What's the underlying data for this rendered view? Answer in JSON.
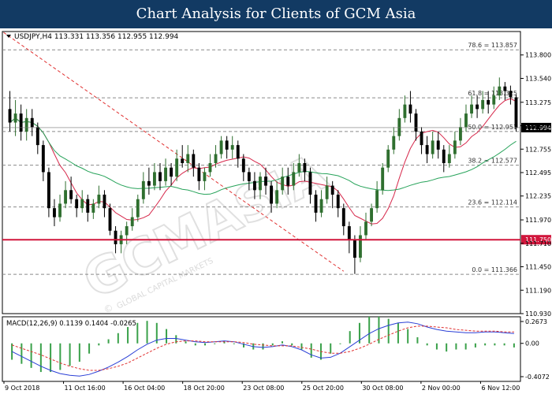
{
  "banner": {
    "title": "Chart Analysis for Clients of GCM Asia"
  },
  "chart_data": {
    "type": "candlestick",
    "header": "USDJPY,H4  113.331 113.356 112.955 112.994",
    "price_axis": {
      "min": 110.93,
      "max": 114.06,
      "ticks": [
        "113.800",
        "113.540",
        "113.275",
        "113.015",
        "112.755",
        "112.495",
        "112.235",
        "111.970",
        "111.710",
        "111.450",
        "111.190",
        "110.930"
      ]
    },
    "current_price": {
      "value": 112.994,
      "label": "112.994"
    },
    "support_line": {
      "value": 111.75,
      "label": "111.750",
      "color": "#d1163c"
    },
    "fibonacci": [
      {
        "value": 113.857,
        "label": "78.6 = 113.857"
      },
      {
        "value": 113.325,
        "label": "61.8 = 113.325"
      },
      {
        "value": 112.951,
        "label": "50.0 = 112.951"
      },
      {
        "value": 112.577,
        "label": "38.2 = 112.577"
      },
      {
        "value": 112.114,
        "label": "23.6 = 112.114"
      },
      {
        "value": 111.366,
        "label": "0.0 = 111.366"
      }
    ],
    "candles": [
      [
        113.2,
        113.05,
        113.4,
        112.95
      ],
      [
        113.05,
        113.15,
        113.3,
        112.9
      ],
      [
        113.15,
        112.95,
        113.25,
        112.85
      ],
      [
        112.95,
        113.1,
        113.2,
        112.85
      ],
      [
        113.1,
        113.0,
        113.2,
        112.9
      ],
      [
        113.0,
        112.8,
        113.05,
        112.7
      ],
      [
        112.8,
        112.5,
        112.85,
        112.4
      ],
      [
        112.5,
        112.1,
        112.55,
        112.0
      ],
      [
        112.1,
        112.0,
        112.2,
        111.9
      ],
      [
        112.0,
        112.15,
        112.25,
        111.95
      ],
      [
        112.15,
        112.3,
        112.4,
        112.1
      ],
      [
        112.3,
        112.2,
        112.45,
        112.15
      ],
      [
        112.2,
        112.1,
        112.25,
        112.0
      ],
      [
        112.1,
        112.2,
        112.3,
        112.05
      ],
      [
        112.2,
        112.05,
        112.25,
        111.95
      ],
      [
        112.05,
        112.15,
        112.2,
        111.98
      ],
      [
        112.15,
        112.25,
        112.35,
        112.1
      ],
      [
        112.25,
        112.1,
        112.3,
        112.0
      ],
      [
        112.1,
        111.85,
        112.15,
        111.8
      ],
      [
        111.85,
        111.7,
        111.9,
        111.6
      ],
      [
        111.7,
        111.8,
        111.85,
        111.6
      ],
      [
        111.8,
        111.9,
        111.95,
        111.7
      ],
      [
        111.9,
        112.0,
        112.1,
        111.85
      ],
      [
        112.0,
        112.2,
        112.25,
        111.95
      ],
      [
        112.2,
        112.4,
        112.5,
        112.15
      ],
      [
        112.4,
        112.35,
        112.55,
        112.25
      ],
      [
        112.35,
        112.5,
        112.6,
        112.3
      ],
      [
        112.5,
        112.4,
        112.6,
        112.3
      ],
      [
        112.4,
        112.55,
        112.65,
        112.35
      ],
      [
        112.55,
        112.45,
        112.6,
        112.35
      ],
      [
        112.45,
        112.65,
        112.75,
        112.4
      ],
      [
        112.65,
        112.6,
        112.8,
        112.55
      ],
      [
        112.6,
        112.7,
        112.8,
        112.5
      ],
      [
        112.7,
        112.55,
        112.75,
        112.45
      ],
      [
        112.55,
        112.4,
        112.6,
        112.3
      ],
      [
        112.4,
        112.5,
        112.55,
        112.3
      ],
      [
        112.5,
        112.6,
        112.7,
        112.45
      ],
      [
        112.6,
        112.7,
        112.8,
        112.55
      ],
      [
        112.7,
        112.85,
        112.9,
        112.65
      ],
      [
        112.85,
        112.75,
        112.9,
        112.65
      ],
      [
        112.75,
        112.8,
        112.9,
        112.65
      ],
      [
        112.8,
        112.65,
        112.85,
        112.55
      ],
      [
        112.65,
        112.5,
        112.7,
        112.4
      ],
      [
        112.5,
        112.4,
        112.55,
        112.3
      ],
      [
        112.4,
        112.3,
        112.5,
        112.2
      ],
      [
        112.3,
        112.45,
        112.5,
        112.2
      ],
      [
        112.45,
        112.35,
        112.55,
        112.25
      ],
      [
        112.35,
        112.15,
        112.4,
        112.05
      ],
      [
        112.15,
        112.3,
        112.4,
        112.1
      ],
      [
        112.3,
        112.45,
        112.55,
        112.25
      ],
      [
        112.45,
        112.35,
        112.55,
        112.25
      ],
      [
        112.35,
        112.5,
        112.6,
        112.3
      ],
      [
        112.5,
        112.6,
        112.7,
        112.45
      ],
      [
        112.6,
        112.5,
        112.65,
        112.4
      ],
      [
        112.5,
        112.25,
        112.55,
        112.15
      ],
      [
        112.25,
        112.05,
        112.3,
        111.95
      ],
      [
        112.05,
        112.2,
        112.3,
        112.0
      ],
      [
        112.2,
        112.35,
        112.45,
        112.15
      ],
      [
        112.35,
        112.25,
        112.4,
        112.1
      ],
      [
        112.25,
        112.1,
        112.3,
        112.0
      ],
      [
        112.1,
        111.9,
        112.15,
        111.8
      ],
      [
        111.9,
        111.75,
        111.95,
        111.6
      ],
      [
        111.75,
        111.55,
        111.8,
        111.37
      ],
      [
        111.55,
        111.8,
        111.9,
        111.5
      ],
      [
        111.8,
        111.95,
        112.05,
        111.75
      ],
      [
        111.95,
        112.1,
        112.15,
        111.9
      ],
      [
        112.1,
        112.3,
        112.4,
        112.05
      ],
      [
        112.3,
        112.55,
        112.6,
        112.25
      ],
      [
        112.55,
        112.75,
        112.8,
        112.5
      ],
      [
        112.75,
        112.9,
        113.0,
        112.7
      ],
      [
        112.9,
        113.1,
        113.2,
        112.85
      ],
      [
        113.1,
        113.25,
        113.35,
        113.05
      ],
      [
        113.25,
        113.15,
        113.4,
        113.05
      ],
      [
        113.15,
        112.95,
        113.2,
        112.85
      ],
      [
        112.95,
        112.8,
        113.0,
        112.7
      ],
      [
        112.8,
        112.7,
        112.9,
        112.6
      ],
      [
        112.7,
        112.85,
        112.95,
        112.65
      ],
      [
        112.85,
        112.75,
        112.95,
        112.65
      ],
      [
        112.75,
        112.6,
        112.8,
        112.5
      ],
      [
        112.6,
        112.7,
        112.8,
        112.55
      ],
      [
        112.7,
        112.85,
        112.95,
        112.65
      ],
      [
        112.85,
        113.0,
        113.1,
        112.8
      ],
      [
        113.0,
        113.15,
        113.25,
        112.95
      ],
      [
        113.15,
        113.25,
        113.35,
        113.1
      ],
      [
        113.25,
        113.2,
        113.35,
        113.1
      ],
      [
        113.2,
        113.3,
        113.4,
        113.15
      ],
      [
        113.3,
        113.25,
        113.4,
        113.15
      ],
      [
        113.25,
        113.35,
        113.45,
        113.2
      ],
      [
        113.35,
        113.45,
        113.55,
        113.3
      ],
      [
        113.45,
        113.4,
        113.5,
        113.3
      ],
      [
        113.4,
        113.33,
        113.46,
        113.25
      ],
      [
        113.33,
        112.99,
        113.36,
        112.95
      ]
    ],
    "moving_averages": [
      {
        "name": "fast",
        "color": "#d6274a"
      },
      {
        "name": "slow",
        "color": "#27a35a"
      }
    ],
    "trendline": {
      "from": [
        0,
        114.05
      ],
      "to": [
        60,
        111.4
      ],
      "color": "#e03030"
    },
    "macd": {
      "label": "MACD(12,26,9) 0.1139 0.1404 -0.0265",
      "ticks": [
        0.2673,
        0.0,
        -0.4072
      ],
      "tick_labels": [
        "0.2673",
        "0.00",
        "-0.4072"
      ],
      "range": [
        -0.4072,
        0.2673
      ],
      "line": [
        -0.1,
        -0.16,
        -0.22,
        -0.28,
        -0.33,
        -0.37,
        -0.39,
        -0.4,
        -0.38,
        -0.34,
        -0.29,
        -0.23,
        -0.16,
        -0.08,
        -0.01,
        0.04,
        0.06,
        0.06,
        0.04,
        0.02,
        0.01,
        0.02,
        0.03,
        0.02,
        -0.01,
        -0.04,
        -0.05,
        -0.04,
        -0.02,
        -0.04,
        -0.08,
        -0.14,
        -0.18,
        -0.17,
        -0.12,
        -0.04,
        0.04,
        0.12,
        0.18,
        0.22,
        0.25,
        0.26,
        0.24,
        0.2,
        0.17,
        0.15,
        0.14,
        0.13,
        0.13,
        0.14,
        0.14,
        0.13,
        0.12
      ],
      "signal": [
        -0.02,
        -0.06,
        -0.1,
        -0.14,
        -0.19,
        -0.24,
        -0.28,
        -0.31,
        -0.33,
        -0.33,
        -0.31,
        -0.28,
        -0.24,
        -0.18,
        -0.12,
        -0.06,
        -0.01,
        0.02,
        0.03,
        0.03,
        0.02,
        0.02,
        0.02,
        0.02,
        0.01,
        -0.01,
        -0.02,
        -0.03,
        -0.03,
        -0.03,
        -0.05,
        -0.07,
        -0.1,
        -0.12,
        -0.12,
        -0.1,
        -0.06,
        -0.01,
        0.05,
        0.1,
        0.15,
        0.19,
        0.21,
        0.21,
        0.2,
        0.19,
        0.17,
        0.16,
        0.15,
        0.15,
        0.15,
        0.14,
        0.14
      ]
    },
    "time_axis": {
      "labels": [
        "9 Oct 2018",
        "11 Oct 16:00",
        "16 Oct 04:00",
        "18 Oct 20:00",
        "23 Oct 08:00",
        "25 Oct 20:00",
        "30 Oct 08:00",
        "2 Nov 00:00",
        "6 Nov 12:00"
      ],
      "positions": [
        0.0,
        0.115,
        0.23,
        0.345,
        0.46,
        0.575,
        0.69,
        0.805,
        0.92
      ]
    }
  },
  "watermark": {
    "brand": "GCMASIA",
    "tagline": "GLOBAL CAPITAL MARKETS",
    "symbol": "©"
  }
}
